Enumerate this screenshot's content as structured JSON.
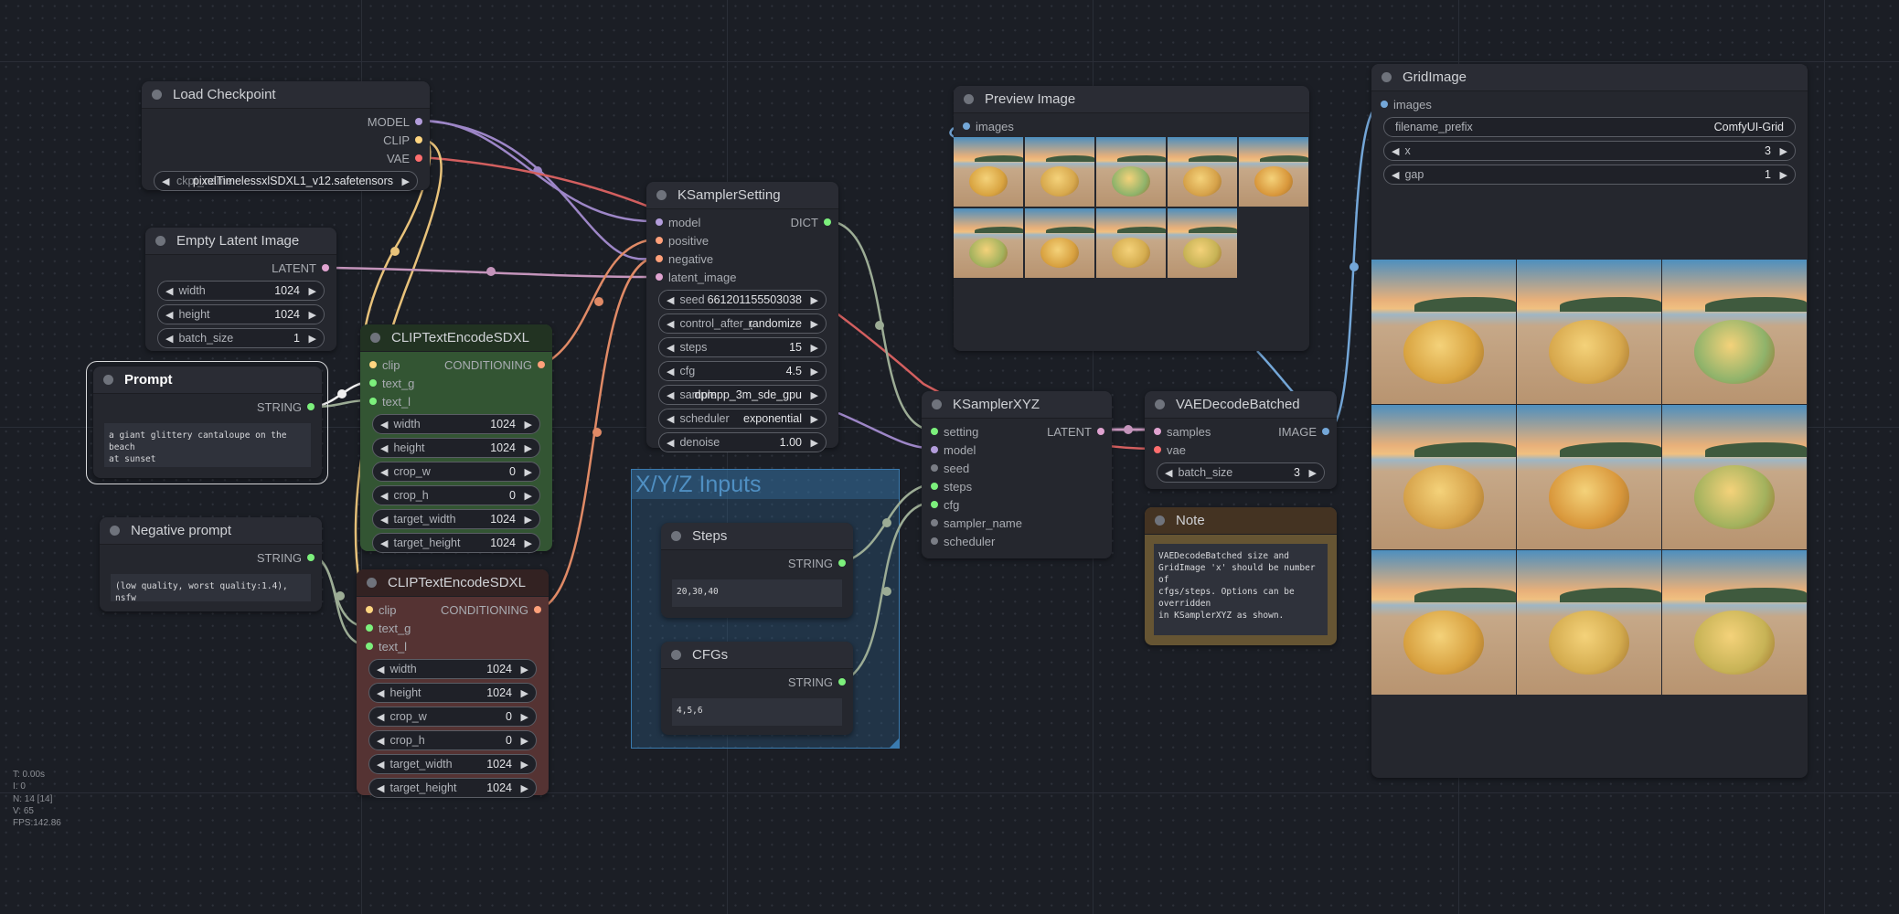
{
  "canvas_stats": {
    "time": "T: 0.00s",
    "i": "I: 0",
    "n": "N: 14 [14]",
    "v": "V: 65",
    "fps": "FPS:142.86"
  },
  "colors": {
    "model": "#b39ddb",
    "clip": "#ffd580",
    "vae": "#ff6e6e",
    "latent": "#e0a3d0",
    "conditioning": "#ffa07a",
    "string": "#7cf07c",
    "image": "#74a7d8",
    "int": "#7a7d85",
    "group": "#3a7bb0"
  },
  "group": {
    "title": "X/Y/Z Inputs"
  },
  "nodes": {
    "load_checkpoint": {
      "title": "Load Checkpoint",
      "outputs": [
        "MODEL",
        "CLIP",
        "VAE"
      ],
      "ckpt_label": "ckpt_name",
      "ckpt_value": "pixelTimelessxlSDXL1_v12.safetensors"
    },
    "empty_latent": {
      "title": "Empty Latent Image",
      "output": "LATENT",
      "widgets": [
        {
          "label": "width",
          "value": "1024"
        },
        {
          "label": "height",
          "value": "1024"
        },
        {
          "label": "batch_size",
          "value": "1"
        }
      ]
    },
    "prompt": {
      "title": "Prompt",
      "output": "STRING",
      "text": "a giant glittery cantaloupe on the beach\nat sunset"
    },
    "negative_prompt": {
      "title": "Negative prompt",
      "output": "STRING",
      "text": "(low quality, worst quality:1.4), nsfw"
    },
    "clip_pos": {
      "title": "CLIPTextEncodeSDXL",
      "inputs": [
        "clip",
        "text_g",
        "text_l"
      ],
      "output": "CONDITIONING",
      "widgets": [
        {
          "label": "width",
          "value": "1024"
        },
        {
          "label": "height",
          "value": "1024"
        },
        {
          "label": "crop_w",
          "value": "0"
        },
        {
          "label": "crop_h",
          "value": "0"
        },
        {
          "label": "target_width",
          "value": "1024"
        },
        {
          "label": "target_height",
          "value": "1024"
        }
      ]
    },
    "clip_neg": {
      "title": "CLIPTextEncodeSDXL",
      "inputs": [
        "clip",
        "text_g",
        "text_l"
      ],
      "output": "CONDITIONING",
      "widgets": [
        {
          "label": "width",
          "value": "1024"
        },
        {
          "label": "height",
          "value": "1024"
        },
        {
          "label": "crop_w",
          "value": "0"
        },
        {
          "label": "crop_h",
          "value": "0"
        },
        {
          "label": "target_width",
          "value": "1024"
        },
        {
          "label": "target_height",
          "value": "1024"
        }
      ]
    },
    "ksampler_setting": {
      "title": "KSamplerSetting",
      "inputs": [
        "model",
        "positive",
        "negative",
        "latent_image"
      ],
      "output": "DICT",
      "widgets": [
        {
          "label": "seed",
          "value": "661201155503038"
        },
        {
          "label": "control_after_generate",
          "value": "randomize"
        },
        {
          "label": "steps",
          "value": "15"
        },
        {
          "label": "cfg",
          "value": "4.5"
        },
        {
          "label": "sampler_name",
          "value": "dpmpp_3m_sde_gpu"
        },
        {
          "label": "scheduler",
          "value": "exponential"
        },
        {
          "label": "denoise",
          "value": "1.00"
        }
      ]
    },
    "steps": {
      "title": "Steps",
      "output": "STRING",
      "text": "20,30,40"
    },
    "cfgs": {
      "title": "CFGs",
      "output": "STRING",
      "text": "4,5,6"
    },
    "preview": {
      "title": "Preview Image",
      "input": "images",
      "image_count": 9
    },
    "ksampler_xyz": {
      "title": "KSamplerXYZ",
      "inputs": [
        "setting",
        "model",
        "seed",
        "steps",
        "cfg",
        "sampler_name",
        "scheduler"
      ],
      "output": "LATENT"
    },
    "vae_decode": {
      "title": "VAEDecodeBatched",
      "inputs": [
        "samples",
        "vae"
      ],
      "output": "IMAGE",
      "widgets": [
        {
          "label": "batch_size",
          "value": "3"
        }
      ]
    },
    "note": {
      "title": "Note",
      "text": "VAEDecodeBatched size and\nGridImage 'x' should be number of\ncfgs/steps. Options can be overridden\nin KSamplerXYZ as shown."
    },
    "grid_image": {
      "title": "GridImage",
      "input": "images",
      "filename_label": "filename_prefix",
      "filename_value": "ComfyUI-Grid",
      "widgets": [
        {
          "label": "x",
          "value": "3"
        },
        {
          "label": "gap",
          "value": "1"
        }
      ],
      "grid_cols": 3,
      "grid_rows": 3
    }
  }
}
